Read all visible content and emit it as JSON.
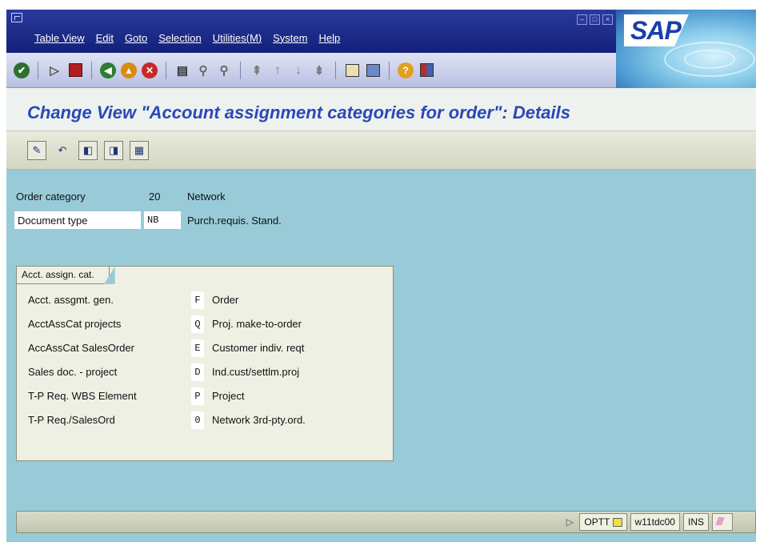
{
  "menu": {
    "items": [
      "Table View",
      "Edit",
      "Goto",
      "Selection",
      "Utilities(M)",
      "System",
      "Help"
    ]
  },
  "brand": {
    "logo_text": "SAP"
  },
  "window_controls": [
    "minimize",
    "restore",
    "close"
  ],
  "standard_toolbar": {
    "icons": [
      "enter-check-icon",
      "command-field-arrow-icon",
      "save-icon",
      "back-icon",
      "exit-icon",
      "cancel-icon",
      "print-icon",
      "find-icon",
      "find-next-icon",
      "first-page-icon",
      "previous-page-icon",
      "next-page-icon",
      "last-page-icon",
      "create-session-icon",
      "shortcut-icon",
      "help-icon",
      "layout-menu-icon"
    ]
  },
  "title": "Change View \"Account assignment categories for order\": Details",
  "app_toolbar": {
    "icons": [
      "display-change-icon",
      "undo-icon",
      "previous-entry-icon",
      "next-entry-icon",
      "variable-list-icon"
    ]
  },
  "header_fields": {
    "order_category": {
      "label": "Order category",
      "code": "20",
      "text": "Network"
    },
    "document_type": {
      "label": "Document type",
      "code": "NB",
      "text": "Purch.requis. Stand."
    }
  },
  "group": {
    "title": "Acct. assign. cat.",
    "rows": [
      {
        "label": "Acct. assgmt. gen.",
        "code": "F",
        "text": "Order"
      },
      {
        "label": "AcctAssCat projects",
        "code": "Q",
        "text": "Proj. make-to-order"
      },
      {
        "label": "AccAssCat SalesOrder",
        "code": "E",
        "text": "Customer indiv. reqt"
      },
      {
        "label": "Sales doc. - project",
        "code": "D",
        "text": "Ind.cust/settlm.proj"
      },
      {
        "label": "T-P Req. WBS Element",
        "code": "P",
        "text": "Project"
      },
      {
        "label": "T-P Req./SalesOrd",
        "code": "0",
        "text": "Network 3rd-pty.ord."
      }
    ]
  },
  "status_bar": {
    "transaction": "OPTT",
    "server": "w11tdc00",
    "mode": "INS"
  },
  "colors": {
    "menubar": "#14207a",
    "title_text": "#2a48b8",
    "main_bg": "#98cbd7",
    "group_bg": "#eef0e4"
  }
}
